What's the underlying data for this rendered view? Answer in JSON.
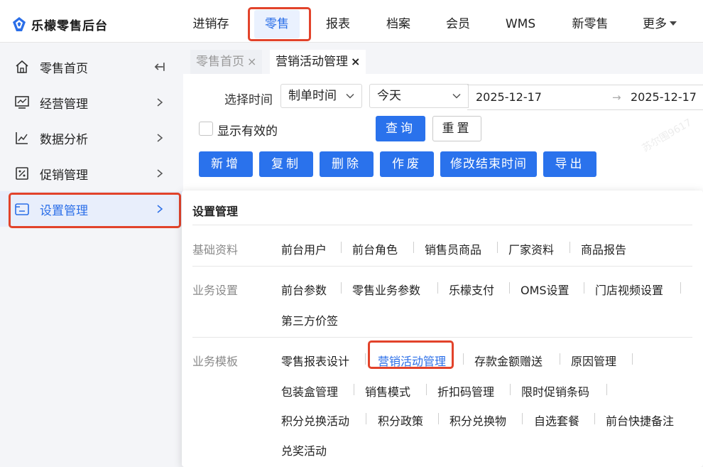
{
  "app": {
    "title": "乐檬零售后台"
  },
  "topnav": {
    "items": [
      {
        "label": "进销存"
      },
      {
        "label": "零售"
      },
      {
        "label": "报表"
      },
      {
        "label": "档案"
      },
      {
        "label": "会员"
      },
      {
        "label": "WMS"
      },
      {
        "label": "新零售"
      },
      {
        "label": "更多"
      }
    ],
    "active": "零售"
  },
  "sidebar": {
    "items": [
      {
        "label": "零售首页",
        "icon": "home-icon"
      },
      {
        "label": "经营管理",
        "icon": "monitor-chart-icon"
      },
      {
        "label": "数据分析",
        "icon": "line-chart-icon"
      },
      {
        "label": "促销管理",
        "icon": "discount-tag-icon"
      },
      {
        "label": "设置管理",
        "icon": "settings-screen-icon"
      }
    ],
    "active": "设置管理"
  },
  "tabs": [
    {
      "label": "零售首页",
      "close": "×"
    },
    {
      "label": "营销活动管理",
      "close": "×"
    }
  ],
  "filters": {
    "time_label": "选择时间",
    "time_type": "制单时间",
    "range_preset": "今天",
    "start_date": "2025-12-17",
    "end_date": "2025-12-17",
    "checkbox_label": "显示有效的",
    "query_button": "查询",
    "reset_button": "重置"
  },
  "toolbar": {
    "add": "新增",
    "copy": "复制",
    "delete": "删除",
    "void": "作废",
    "modify_end": "修改结束时间",
    "export": "导出"
  },
  "panel": {
    "title": "设置管理",
    "groups": [
      {
        "label": "基础资料",
        "links": [
          "前台用户",
          "前台角色",
          "销售员商品",
          "厂家资料",
          "商品报告"
        ]
      },
      {
        "label": "业务设置",
        "links": [
          "前台参数",
          "零售业务参数",
          "乐檬支付",
          "OMS设置",
          "门店视频设置",
          "第三方价签"
        ]
      },
      {
        "label": "业务模板",
        "links": [
          "零售报表设计",
          "营销活动管理",
          "存款金额赠送",
          "原因管理",
          "包装盒管理",
          "销售模式",
          "折扣码管理",
          "限时促销条码",
          "积分兑换活动",
          "积分政策",
          "积分兑换物",
          "自选套餐",
          "前台快捷备注",
          "兑奖活动"
        ]
      }
    ],
    "active_link": "营销活动管理"
  },
  "watermark": "苏尔围9617",
  "colors": {
    "accent": "#2a6ee8",
    "highlight_box": "#e2432b",
    "primary_button": "#2a72ec"
  }
}
